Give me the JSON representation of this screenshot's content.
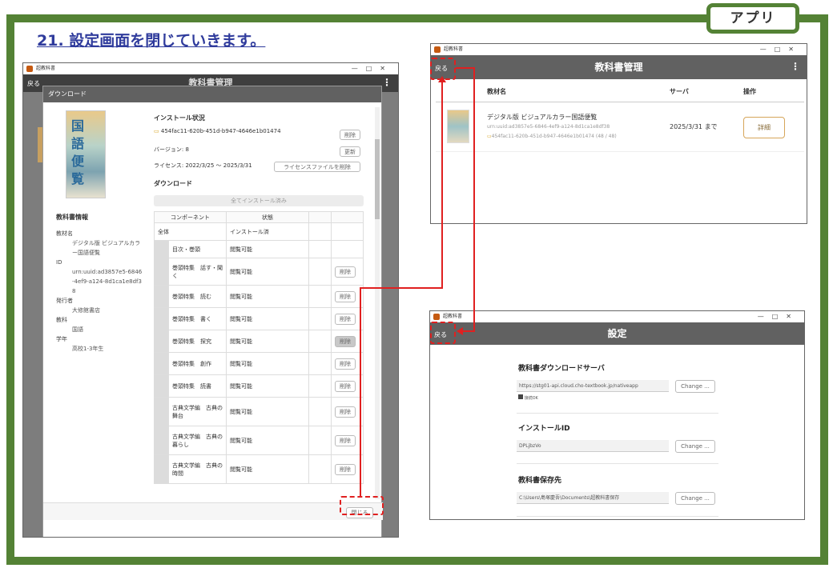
{
  "page": {
    "step_title": "21. 設定画面を閉じていきます。",
    "app_tag": "アプリ"
  },
  "left_window": {
    "app_name": "超教科書",
    "back": "戻る",
    "title": "教科書管理",
    "dialog": {
      "title": "ダウンロード",
      "cover_text": "国語便覧",
      "info_heading": "教科書情報",
      "fields": [
        {
          "label": "教材名",
          "value": "デジタル版 ビジュアルカラー国語便覧"
        },
        {
          "label": "ID",
          "value": "urn:uuid:ad3857e5-6846-4ef9-a124-8d1ca1e8df38"
        },
        {
          "label": "発行者",
          "value": "大修館書店"
        },
        {
          "label": "教科",
          "value": "国語"
        },
        {
          "label": "学年",
          "value": "高校1-3年生"
        }
      ],
      "install_heading": "インストール状況",
      "folder_id": "454fac11-620b-451d-b947-4646e1b01474",
      "delete_label": "削除",
      "version": "バージョン: 8",
      "update_label": "更新",
      "license": "ライセンス: 2022/3/25 ～ 2025/3/31",
      "license_delete_label": "ライセンスファイルを削除",
      "download_heading": "ダウンロード",
      "all_installed_label": "全てインストール済み",
      "table_headers": [
        "コンポーネント",
        "状態"
      ],
      "all_row": {
        "name": "全体",
        "status": "インストール済"
      },
      "rows": [
        {
          "name": "目次・巻頭",
          "status": "閲覧可能",
          "btn": ""
        },
        {
          "name": "巻頭特集　話す・聞く",
          "status": "閲覧可能",
          "btn": "削除"
        },
        {
          "name": "巻頭特集　読む",
          "status": "閲覧可能",
          "btn": "削除"
        },
        {
          "name": "巻頭特集　書く",
          "status": "閲覧可能",
          "btn": "削除"
        },
        {
          "name": "巻頭特集　探究",
          "status": "閲覧可能",
          "btn": "削除"
        },
        {
          "name": "巻頭特集　創作",
          "status": "閲覧可能",
          "btn": "削除"
        },
        {
          "name": "巻頭特集　読書",
          "status": "閲覧可能",
          "btn": "削除"
        },
        {
          "name": "古典文学編　古典の舞台",
          "status": "閲覧可能",
          "btn": "削除"
        },
        {
          "name": "古典文学編　古典の暮らし",
          "status": "閲覧可能",
          "btn": "削除"
        },
        {
          "name": "古典文学編　古典の時間",
          "status": "閲覧可能",
          "btn": "削除"
        }
      ],
      "close_label": "閉じる"
    }
  },
  "top_right_window": {
    "app_name": "超教科書",
    "back": "戻る",
    "title": "教科書管理",
    "col_name": "教材名",
    "col_server": "サーバ",
    "col_action": "操作",
    "book_title": "デジタル版 ビジュアルカラー国語便覧",
    "book_urn": "urn:uuid:ad3857e5-6846-4ef9-a124-8d1ca1e8df38",
    "book_folder": "454fac11-620b-451d-b947-4646e1b01474 (48 / 48)",
    "server_date": "2025/3/31 まで",
    "detail_label": "詳細"
  },
  "bottom_right_window": {
    "app_name": "超教科書",
    "back": "戻る",
    "title": "設定",
    "server_heading": "教科書ダウンロードサーバ",
    "server_url": "https://stg01-api.cloud.cho-textbook.jp/nativeapp",
    "server_ok": "接続OK",
    "change_label": "Change ...",
    "install_id_heading": "インストールID",
    "install_id": "DPLjbzVo",
    "save_heading": "教科書保存先",
    "save_path": "C:\\Users\\島塚慶吾\\Documents\\超教科書保存"
  }
}
